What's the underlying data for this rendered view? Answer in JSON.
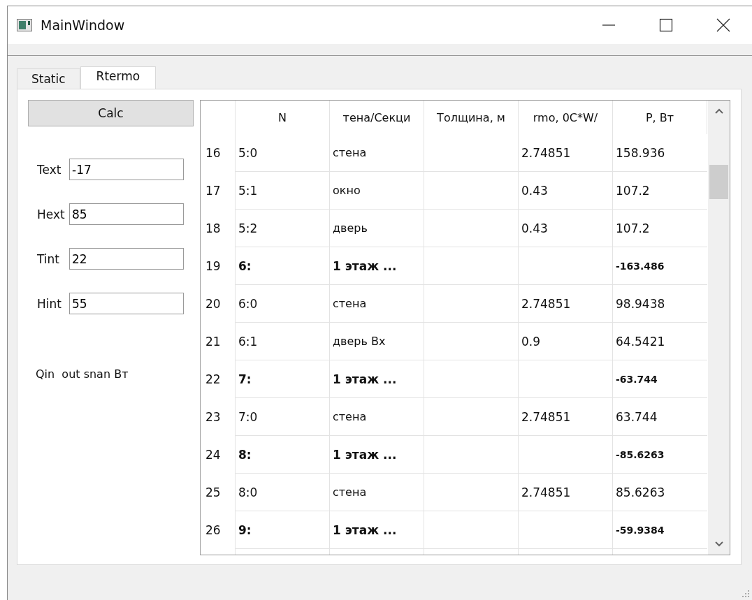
{
  "window": {
    "title": "MainWindow"
  },
  "tabs": [
    {
      "label": "Static",
      "selected": false
    },
    {
      "label": "Rtermo",
      "selected": true
    }
  ],
  "calc_button": "Calc",
  "fields": [
    {
      "label": "Text",
      "value": "-17"
    },
    {
      "label": "Hext",
      "value": "85"
    },
    {
      "label": "Tint",
      "value": "22"
    },
    {
      "label": "Hint",
      "value": "55"
    }
  ],
  "result_label": "Qin  out snan Вт",
  "table": {
    "columns": [
      "N",
      "тена/Секци",
      "Толщина, м",
      "rmo, 0C*W/",
      "P, Вт"
    ],
    "rows": [
      {
        "number": "16",
        "kind": "item",
        "cells": [
          "5:0",
          "стена",
          "",
          "2.74851",
          "158.936"
        ]
      },
      {
        "number": "17",
        "kind": "item",
        "cells": [
          "5:1",
          "окно",
          "",
          "0.43",
          "107.2"
        ]
      },
      {
        "number": "18",
        "kind": "item",
        "cells": [
          "5:2",
          "дверь",
          "",
          "0.43",
          "107.2"
        ]
      },
      {
        "number": "19",
        "kind": "section",
        "cells": [
          "6:",
          "1 этаж ...",
          "",
          "",
          "-163.486"
        ]
      },
      {
        "number": "20",
        "kind": "item",
        "cells": [
          "6:0",
          "стена",
          "",
          "2.74851",
          "98.9438"
        ]
      },
      {
        "number": "21",
        "kind": "item",
        "cells": [
          "6:1",
          "дверь Вх",
          "",
          "0.9",
          "64.5421"
        ]
      },
      {
        "number": "22",
        "kind": "section",
        "cells": [
          "7:",
          "1 этаж ...",
          "",
          "",
          "-63.744"
        ]
      },
      {
        "number": "23",
        "kind": "item",
        "cells": [
          "7:0",
          "стена",
          "",
          "2.74851",
          "63.744"
        ]
      },
      {
        "number": "24",
        "kind": "section",
        "cells": [
          "8:",
          "1 этаж ...",
          "",
          "",
          "-85.6263"
        ]
      },
      {
        "number": "25",
        "kind": "item",
        "cells": [
          "8:0",
          "стена",
          "",
          "2.74851",
          "85.6263"
        ]
      },
      {
        "number": "26",
        "kind": "section",
        "cells": [
          "9:",
          "1 этаж ...",
          "",
          "",
          "-59.9384"
        ]
      }
    ]
  }
}
